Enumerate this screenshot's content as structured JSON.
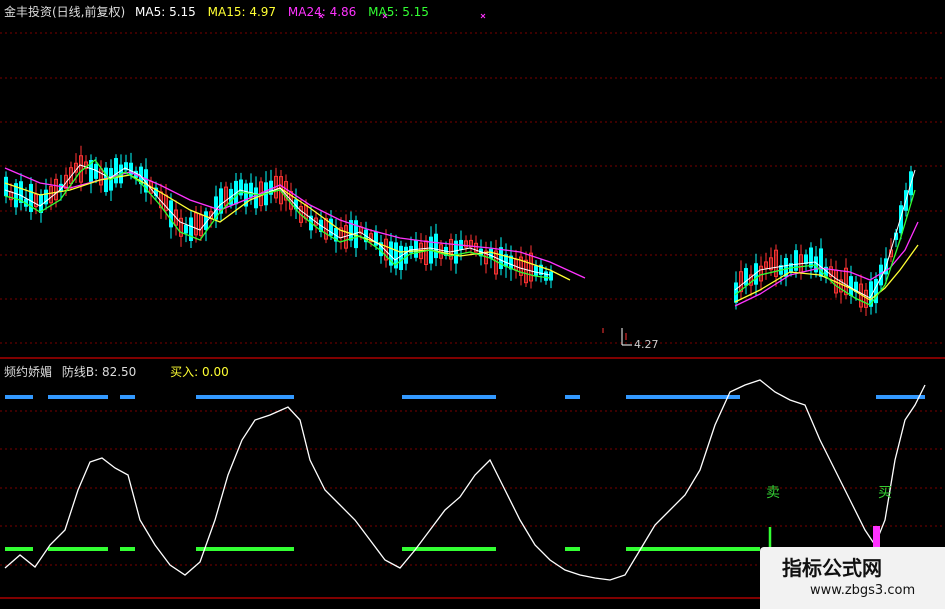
{
  "header": {
    "title": "金丰投资(日线,前复权)",
    "indicators": [
      {
        "label": "MA5:",
        "value": "5.15",
        "color": "#ffffff"
      },
      {
        "label": "MA15:",
        "value": "4.97",
        "color": "#ffff33"
      },
      {
        "label": "MA24:",
        "value": "4.86",
        "color": "#ff33ff"
      },
      {
        "label": "MA5:",
        "value": "5.15",
        "color": "#33ff33"
      }
    ]
  },
  "price_chart": {
    "low_label": "4.27"
  },
  "indicator_panel": {
    "name": "频约娇媚",
    "defense_label": "防线B:",
    "defense_value": "82.50",
    "buy_label": "买入:",
    "buy_value": "0.00",
    "sell_marker": "卖",
    "buy_marker": "买"
  },
  "watermark": {
    "title": "指标公式网",
    "url": "www.zbgs3.com"
  },
  "colors": {
    "background": "#000000",
    "grid": "#7a0000",
    "up_candle": "#ff3333",
    "down_candle": "#00ffff",
    "osc_line": "#ffffff",
    "blue_bar": "#3399ff",
    "green_bar": "#33ff33",
    "buy_signal": "#ff33ff"
  }
}
